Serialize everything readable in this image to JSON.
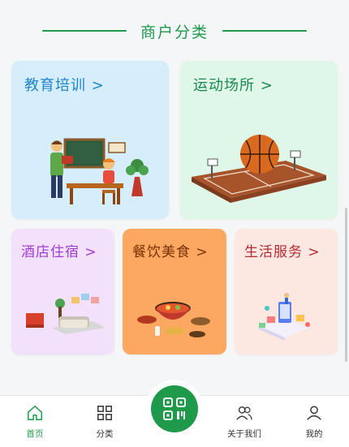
{
  "header": {
    "title": "商户分类"
  },
  "categories": [
    {
      "label": "教育培训 >"
    },
    {
      "label": "运动场所 >"
    },
    {
      "label": "酒店住宿 >"
    },
    {
      "label": "餐饮美食 >"
    },
    {
      "label": "生活服务 >"
    }
  ],
  "tabbar": {
    "items": [
      {
        "label": "首页",
        "icon": "home-icon",
        "active": true
      },
      {
        "label": "分类",
        "icon": "grid-icon"
      },
      {
        "label": "",
        "icon": "qr-code-icon"
      },
      {
        "label": "关于我们",
        "icon": "users-icon"
      },
      {
        "label": "我的",
        "icon": "user-icon"
      }
    ]
  },
  "colors": {
    "accent": "#1f9a4b"
  }
}
